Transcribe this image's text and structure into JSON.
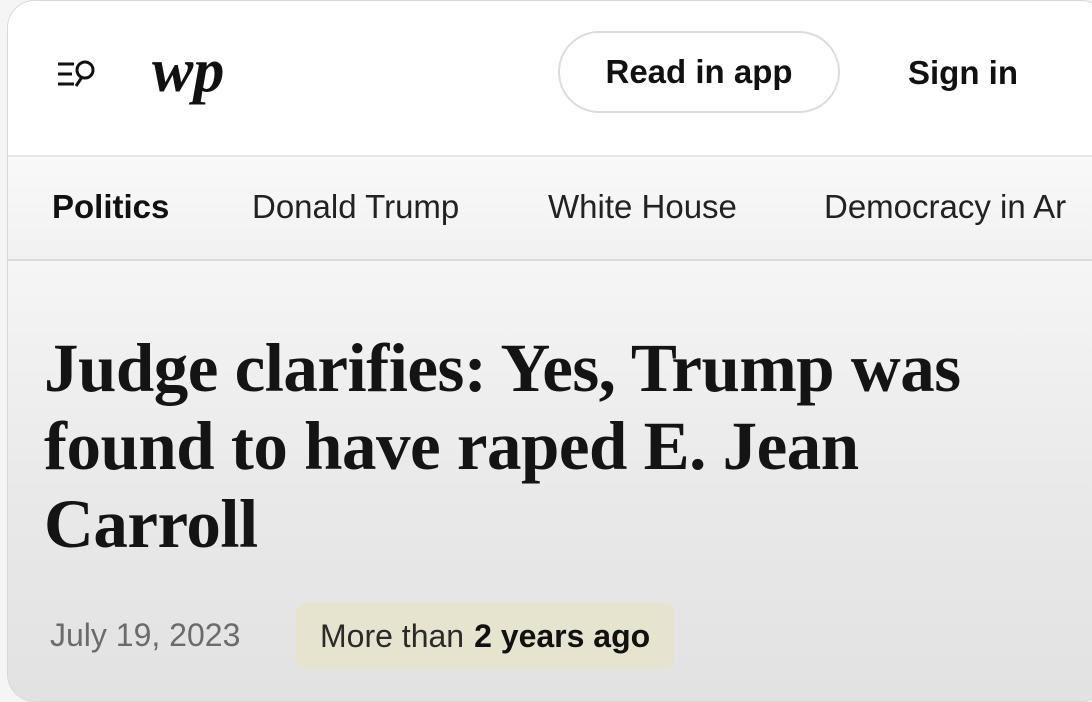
{
  "header": {
    "logo_text": "wp",
    "read_in_app_label": "Read in app",
    "sign_in_label": "Sign in"
  },
  "nav": {
    "items": [
      {
        "label": "Politics",
        "active": true
      },
      {
        "label": "Donald Trump",
        "active": false
      },
      {
        "label": "White House",
        "active": false
      },
      {
        "label": "Democracy in Ar",
        "active": false
      }
    ]
  },
  "article": {
    "headline": "Judge clarifies: Yes, Trump was found to have raped E. Jean Carroll",
    "date": "July 19, 2023",
    "age_prefix": "More than",
    "age_value": "2 years ago"
  },
  "colors": {
    "badge_background": "#e6e3cf",
    "text_primary": "#111111",
    "text_secondary": "#6b6b6b"
  },
  "icons": {
    "menu_search": "menu-search-icon",
    "logo": "washington-post-logo"
  }
}
